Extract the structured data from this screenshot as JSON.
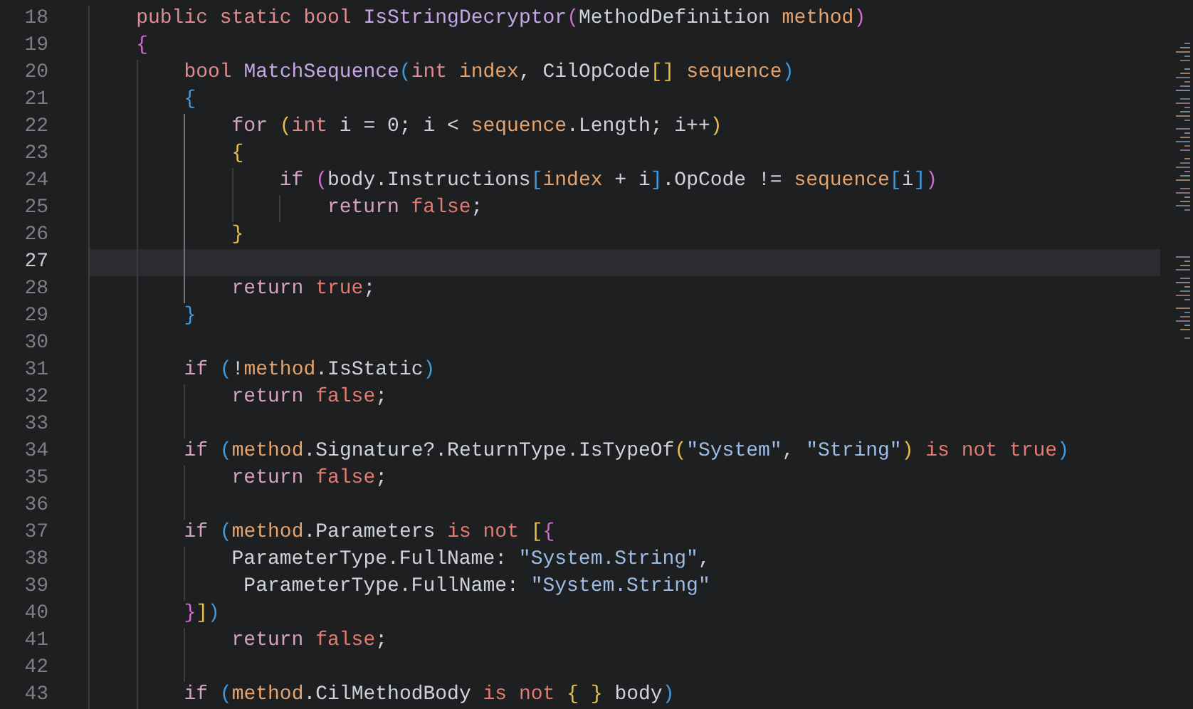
{
  "lines": [
    {
      "number": "18",
      "selected": false,
      "guides": [
        {
          "active": false
        }
      ],
      "tokens": [
        {
          "kind": "keyword",
          "text": "public static bool "
        },
        {
          "kind": "method",
          "text": "IsStringDecryptor"
        },
        {
          "kind": "bracket1",
          "text": "("
        },
        {
          "kind": "plain",
          "text": "MethodDefinition "
        },
        {
          "kind": "param",
          "text": "method"
        },
        {
          "kind": "bracket1",
          "text": ")"
        }
      ]
    },
    {
      "number": "19",
      "selected": false,
      "guides": [
        {
          "active": false
        }
      ],
      "tokens": [
        {
          "kind": "bracket1",
          "text": "{"
        }
      ]
    },
    {
      "number": "20",
      "selected": false,
      "guides": [
        {
          "active": false
        },
        {
          "active": false
        }
      ],
      "tokens": [
        {
          "kind": "keyword",
          "text": "bool "
        },
        {
          "kind": "method",
          "text": "MatchSequence"
        },
        {
          "kind": "bracket2",
          "text": "("
        },
        {
          "kind": "keyword",
          "text": "int "
        },
        {
          "kind": "param",
          "text": "index"
        },
        {
          "kind": "plain",
          "text": ", CilOpCode"
        },
        {
          "kind": "bracket3",
          "text": "[] "
        },
        {
          "kind": "param",
          "text": "sequence"
        },
        {
          "kind": "bracket2",
          "text": ")"
        }
      ]
    },
    {
      "number": "21",
      "selected": false,
      "guides": [
        {
          "active": false
        },
        {
          "active": false
        }
      ],
      "tokens": [
        {
          "kind": "bracket2",
          "text": "{"
        }
      ]
    },
    {
      "number": "22",
      "selected": false,
      "guides": [
        {
          "active": false
        },
        {
          "active": false
        },
        {
          "active": true
        }
      ],
      "tokens": [
        {
          "kind": "control",
          "text": "for "
        },
        {
          "kind": "bracket3",
          "text": "("
        },
        {
          "kind": "keyword",
          "text": "int "
        },
        {
          "kind": "plain",
          "text": "i = 0; i < "
        },
        {
          "kind": "param",
          "text": "sequence"
        },
        {
          "kind": "plain",
          "text": ".Length; i++"
        },
        {
          "kind": "bracket3",
          "text": ")"
        }
      ]
    },
    {
      "number": "23",
      "selected": false,
      "guides": [
        {
          "active": false
        },
        {
          "active": false
        },
        {
          "active": true
        }
      ],
      "tokens": [
        {
          "kind": "bracket3",
          "text": "{"
        }
      ]
    },
    {
      "number": "24",
      "selected": false,
      "guides": [
        {
          "active": false
        },
        {
          "active": false
        },
        {
          "active": true
        },
        {
          "active": false
        }
      ],
      "tokens": [
        {
          "kind": "control",
          "text": "if "
        },
        {
          "kind": "bracket1",
          "text": "("
        },
        {
          "kind": "plain",
          "text": "body.Instructions"
        },
        {
          "kind": "bracket2",
          "text": "["
        },
        {
          "kind": "param",
          "text": "index"
        },
        {
          "kind": "plain",
          "text": " + i"
        },
        {
          "kind": "bracket2",
          "text": "]"
        },
        {
          "kind": "plain",
          "text": ".OpCode != "
        },
        {
          "kind": "param",
          "text": "sequence"
        },
        {
          "kind": "bracket2",
          "text": "["
        },
        {
          "kind": "plain",
          "text": "i"
        },
        {
          "kind": "bracket2",
          "text": "]"
        },
        {
          "kind": "bracket1",
          "text": ")"
        }
      ]
    },
    {
      "number": "25",
      "selected": false,
      "guides": [
        {
          "active": false
        },
        {
          "active": false
        },
        {
          "active": true
        },
        {
          "active": false
        },
        {
          "active": false
        }
      ],
      "tokens": [
        {
          "kind": "control",
          "text": "return "
        },
        {
          "kind": "literal",
          "text": "false"
        },
        {
          "kind": "plain",
          "text": ";"
        }
      ]
    },
    {
      "number": "26",
      "selected": false,
      "guides": [
        {
          "active": false
        },
        {
          "active": false
        },
        {
          "active": true
        }
      ],
      "tokens": [
        {
          "kind": "bracket3",
          "text": "}"
        }
      ]
    },
    {
      "number": "27",
      "selected": true,
      "guides": [
        {
          "active": false
        },
        {
          "active": false
        },
        {
          "active": true
        }
      ]
    },
    {
      "number": "28",
      "selected": false,
      "guides": [
        {
          "active": false
        },
        {
          "active": false
        },
        {
          "active": true
        }
      ],
      "tokens": [
        {
          "kind": "control",
          "text": "return "
        },
        {
          "kind": "literal",
          "text": "true"
        },
        {
          "kind": "plain",
          "text": ";"
        }
      ]
    },
    {
      "number": "29",
      "selected": false,
      "guides": [
        {
          "active": false
        },
        {
          "active": false
        }
      ],
      "tokens": [
        {
          "kind": "bracket2",
          "text": "}"
        }
      ]
    },
    {
      "number": "30",
      "selected": false,
      "guides": [
        {
          "active": false
        },
        {
          "active": false
        }
      ]
    },
    {
      "number": "31",
      "selected": false,
      "guides": [
        {
          "active": false
        },
        {
          "active": false
        }
      ],
      "tokens": [
        {
          "kind": "control",
          "text": "if "
        },
        {
          "kind": "bracket2",
          "text": "("
        },
        {
          "kind": "plain",
          "text": "!"
        },
        {
          "kind": "param",
          "text": "method"
        },
        {
          "kind": "plain",
          "text": ".IsStatic"
        },
        {
          "kind": "bracket2",
          "text": ")"
        }
      ]
    },
    {
      "number": "32",
      "selected": false,
      "guides": [
        {
          "active": false
        },
        {
          "active": false
        },
        {
          "active": false
        }
      ],
      "tokens": [
        {
          "kind": "control",
          "text": "return "
        },
        {
          "kind": "literal",
          "text": "false"
        },
        {
          "kind": "plain",
          "text": ";"
        }
      ]
    },
    {
      "number": "33",
      "selected": false,
      "guides": [
        {
          "active": false
        },
        {
          "active": false
        },
        {
          "active": false
        }
      ]
    },
    {
      "number": "34",
      "selected": false,
      "guides": [
        {
          "active": false
        },
        {
          "active": false
        }
      ],
      "tokens": [
        {
          "kind": "control",
          "text": "if "
        },
        {
          "kind": "bracket2",
          "text": "("
        },
        {
          "kind": "param",
          "text": "method"
        },
        {
          "kind": "plain",
          "text": ".Signature?.ReturnType.IsTypeOf"
        },
        {
          "kind": "bracket3",
          "text": "("
        },
        {
          "kind": "string",
          "text": "\"System\""
        },
        {
          "kind": "plain",
          "text": ", "
        },
        {
          "kind": "string",
          "text": "\"String\""
        },
        {
          "kind": "bracket3",
          "text": ") "
        },
        {
          "kind": "literal",
          "text": "is not true"
        },
        {
          "kind": "bracket2",
          "text": ")"
        }
      ]
    },
    {
      "number": "35",
      "selected": false,
      "guides": [
        {
          "active": false
        },
        {
          "active": false
        },
        {
          "active": false
        }
      ],
      "tokens": [
        {
          "kind": "control",
          "text": "return "
        },
        {
          "kind": "literal",
          "text": "false"
        },
        {
          "kind": "plain",
          "text": ";"
        }
      ]
    },
    {
      "number": "36",
      "selected": false,
      "guides": [
        {
          "active": false
        },
        {
          "active": false
        },
        {
          "active": false
        }
      ]
    },
    {
      "number": "37",
      "selected": false,
      "guides": [
        {
          "active": false
        },
        {
          "active": false
        }
      ],
      "tokens": [
        {
          "kind": "control",
          "text": "if "
        },
        {
          "kind": "bracket2",
          "text": "("
        },
        {
          "kind": "param",
          "text": "method"
        },
        {
          "kind": "plain",
          "text": ".Parameters "
        },
        {
          "kind": "literal",
          "text": "is not "
        },
        {
          "kind": "bracket3",
          "text": "["
        },
        {
          "kind": "bracket1",
          "text": "{"
        }
      ]
    },
    {
      "number": "38",
      "selected": false,
      "guides": [
        {
          "active": false
        },
        {
          "active": false
        },
        {
          "active": false
        }
      ],
      "tokens": [
        {
          "kind": "plain",
          "text": "ParameterType.FullName: "
        },
        {
          "kind": "string",
          "text": "\"System.String\""
        },
        {
          "kind": "plain",
          "text": ","
        }
      ]
    },
    {
      "number": "39",
      "selected": false,
      "guides": [
        {
          "active": false
        },
        {
          "active": false
        },
        {
          "active": false
        }
      ],
      "tokens": [
        {
          "kind": "plain",
          "text": " ParameterType.FullName: "
        },
        {
          "kind": "string",
          "text": "\"System.String\""
        }
      ]
    },
    {
      "number": "40",
      "selected": false,
      "guides": [
        {
          "active": false
        },
        {
          "active": false
        }
      ],
      "tokens": [
        {
          "kind": "bracket1",
          "text": "}"
        },
        {
          "kind": "bracket3",
          "text": "]"
        },
        {
          "kind": "bracket2",
          "text": ")"
        }
      ]
    },
    {
      "number": "41",
      "selected": false,
      "guides": [
        {
          "active": false
        },
        {
          "active": false
        },
        {
          "active": false
        }
      ],
      "tokens": [
        {
          "kind": "control",
          "text": "return "
        },
        {
          "kind": "literal",
          "text": "false"
        },
        {
          "kind": "plain",
          "text": ";"
        }
      ]
    },
    {
      "number": "42",
      "selected": false,
      "guides": [
        {
          "active": false
        },
        {
          "active": false
        },
        {
          "active": false
        }
      ]
    },
    {
      "number": "43",
      "selected": false,
      "guides": [
        {
          "active": false
        },
        {
          "active": false
        }
      ],
      "tokens": [
        {
          "kind": "control",
          "text": "if "
        },
        {
          "kind": "bracket2",
          "text": "("
        },
        {
          "kind": "param",
          "text": "method"
        },
        {
          "kind": "plain",
          "text": ".CilMethodBody "
        },
        {
          "kind": "literal",
          "text": "is not "
        },
        {
          "kind": "bracket3",
          "text": "{ }"
        },
        {
          "kind": "plain",
          "text": " body"
        },
        {
          "kind": "bracket2",
          "text": ")"
        }
      ]
    }
  ]
}
